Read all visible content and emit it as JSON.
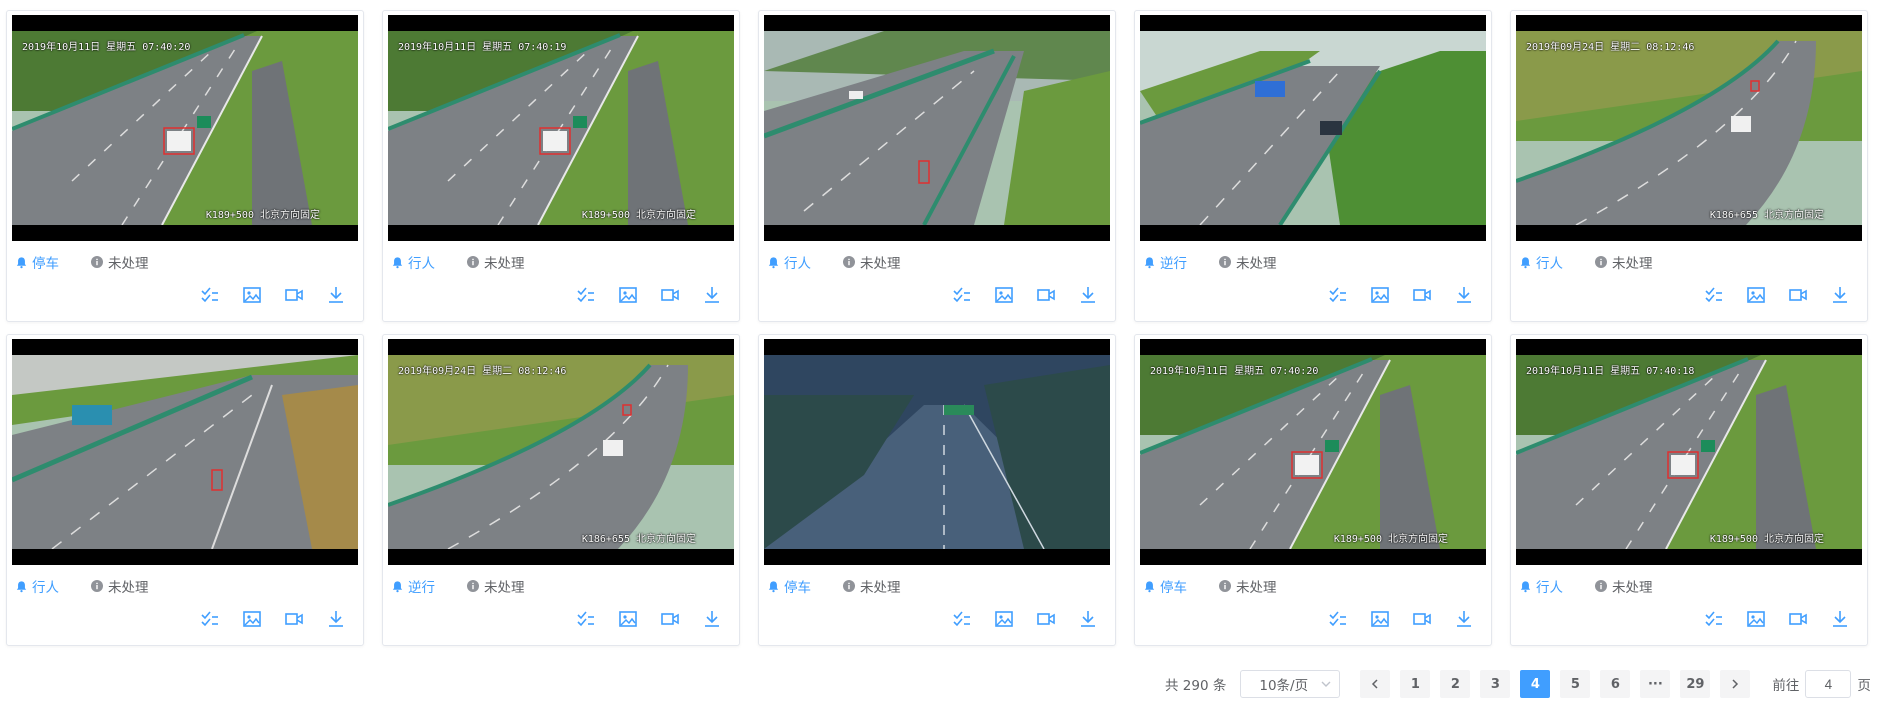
{
  "colors": {
    "accent": "#409eff",
    "text": "#606266",
    "border": "#e4e7ed",
    "pager_bg": "#f4f4f5"
  },
  "cards": [
    {
      "event_type": "停车",
      "status": "未处理",
      "osd_top": "2019年10月11日 星期五 07:40:20",
      "osd_bottom": "K189+500 北京方向固定",
      "scene": "curve"
    },
    {
      "event_type": "行人",
      "status": "未处理",
      "osd_top": "2019年10月11日 星期五 07:40:19",
      "osd_bottom": "K189+500 北京方向固定",
      "scene": "curve"
    },
    {
      "event_type": "行人",
      "status": "未处理",
      "osd_top": "",
      "osd_bottom": "",
      "scene": "wide"
    },
    {
      "event_type": "逆行",
      "status": "未处理",
      "osd_top": "",
      "osd_bottom": "",
      "scene": "green"
    },
    {
      "event_type": "行人",
      "status": "未处理",
      "osd_top": "2019年09月24日 星期二 08:12:46",
      "osd_bottom": "K186+655 北京方向固定",
      "scene": "bend"
    },
    {
      "event_type": "行人",
      "status": "未处理",
      "osd_top": "",
      "osd_bottom": "",
      "scene": "truck"
    },
    {
      "event_type": "逆行",
      "status": "未处理",
      "osd_top": "2019年09月24日 星期二 08:12:46",
      "osd_bottom": "K186+655 北京方向固定",
      "scene": "bend"
    },
    {
      "event_type": "停车",
      "status": "未处理",
      "osd_top": "",
      "osd_bottom": "",
      "scene": "dusk"
    },
    {
      "event_type": "停车",
      "status": "未处理",
      "osd_top": "2019年10月11日 星期五 07:40:20",
      "osd_bottom": "K189+500 北京方向固定",
      "scene": "curve"
    },
    {
      "event_type": "行人",
      "status": "未处理",
      "osd_top": "2019年10月11日 星期五 07:40:18",
      "osd_bottom": "K189+500 北京方向固定",
      "scene": "curve"
    }
  ],
  "action_icons": [
    "check-list-icon",
    "image-icon",
    "video-icon",
    "download-icon"
  ],
  "pagination": {
    "total_text": "共 290 条",
    "page_size": "10条/页",
    "pages": [
      "1",
      "2",
      "3",
      "4",
      "5",
      "6",
      "···",
      "29"
    ],
    "current": "4",
    "goto_prefix": "前往",
    "goto_value": "4",
    "goto_suffix": "页"
  }
}
